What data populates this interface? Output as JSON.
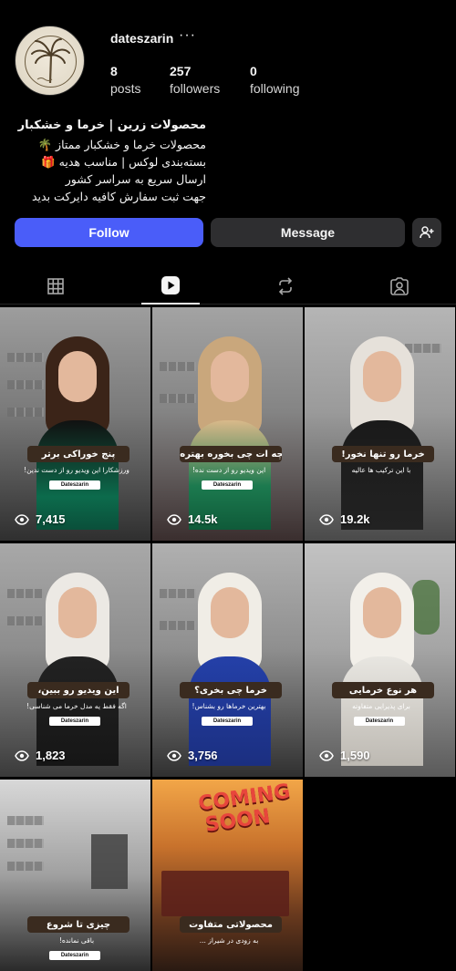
{
  "profile": {
    "username": "dateszarin",
    "more_glyph": "···",
    "avatar_icon": "palm-logo-icon",
    "stats": {
      "posts": {
        "value": "8",
        "label": "posts"
      },
      "followers": {
        "value": "257",
        "label": "followers"
      },
      "following": {
        "value": "0",
        "label": "following"
      }
    },
    "bio": {
      "name": "محصولات زرین | خرما و خشکبار",
      "lines": [
        "محصولات خرما و خشکبار ممتاز 🌴",
        "بسته‌بندی لوکس | مناسب هدیه 🎁",
        "ارسال سریع به سراسر کشور",
        "جهت ثبت سفارش کافیه دایرکت بدید"
      ]
    }
  },
  "actions": {
    "follow": "Follow",
    "message": "Message",
    "add_user_icon": "add-user-icon"
  },
  "tabs": [
    {
      "name": "posts",
      "icon": "grid-icon",
      "active": false
    },
    {
      "name": "reels",
      "icon": "reels-icon",
      "active": true
    },
    {
      "name": "reposts",
      "icon": "repost-icon",
      "active": false
    },
    {
      "name": "tagged",
      "icon": "tagged-icon",
      "active": false
    }
  ],
  "reels": [
    {
      "title": "پنج خوراکی برتر",
      "subtitle": "ورزشکارا این ویدیو رو از دست ندین!",
      "views": "7,415"
    },
    {
      "title": "بچه ات چی بخوره بهتره؟",
      "subtitle": "این ویدیو رو از دست نده!",
      "views": "14.5k"
    },
    {
      "title": "خرما رو تنها نخور!",
      "subtitle": "با این ترکیب ها عالیه",
      "views": "19.2k"
    },
    {
      "title": "این ویدیو رو ببین،",
      "subtitle": "اگه فقط یه مدل خرما می شناسی!",
      "views": "1,823"
    },
    {
      "title": "خرما چی بخری؟",
      "subtitle": "بهترین خرماها رو بشناس!",
      "views": "3,756"
    },
    {
      "title": "هر نوع خرمایی",
      "subtitle": "برای پذیرایی متفاوته",
      "views": "1,590"
    },
    {
      "title": "چیزی تا شروع",
      "subtitle": "باقی نمانده!",
      "views": ""
    },
    {
      "title": "محصولاتی متفاوت",
      "subtitle": "به زودی در شیراز ...",
      "views": "",
      "poster_text": "COMING SOON"
    }
  ],
  "brand_tag": "Dateszarin",
  "colors": {
    "background": "#000000",
    "follow_button": "#4a5df9",
    "secondary_button": "#2e2e30",
    "caption_box": "#3a2b1f"
  }
}
